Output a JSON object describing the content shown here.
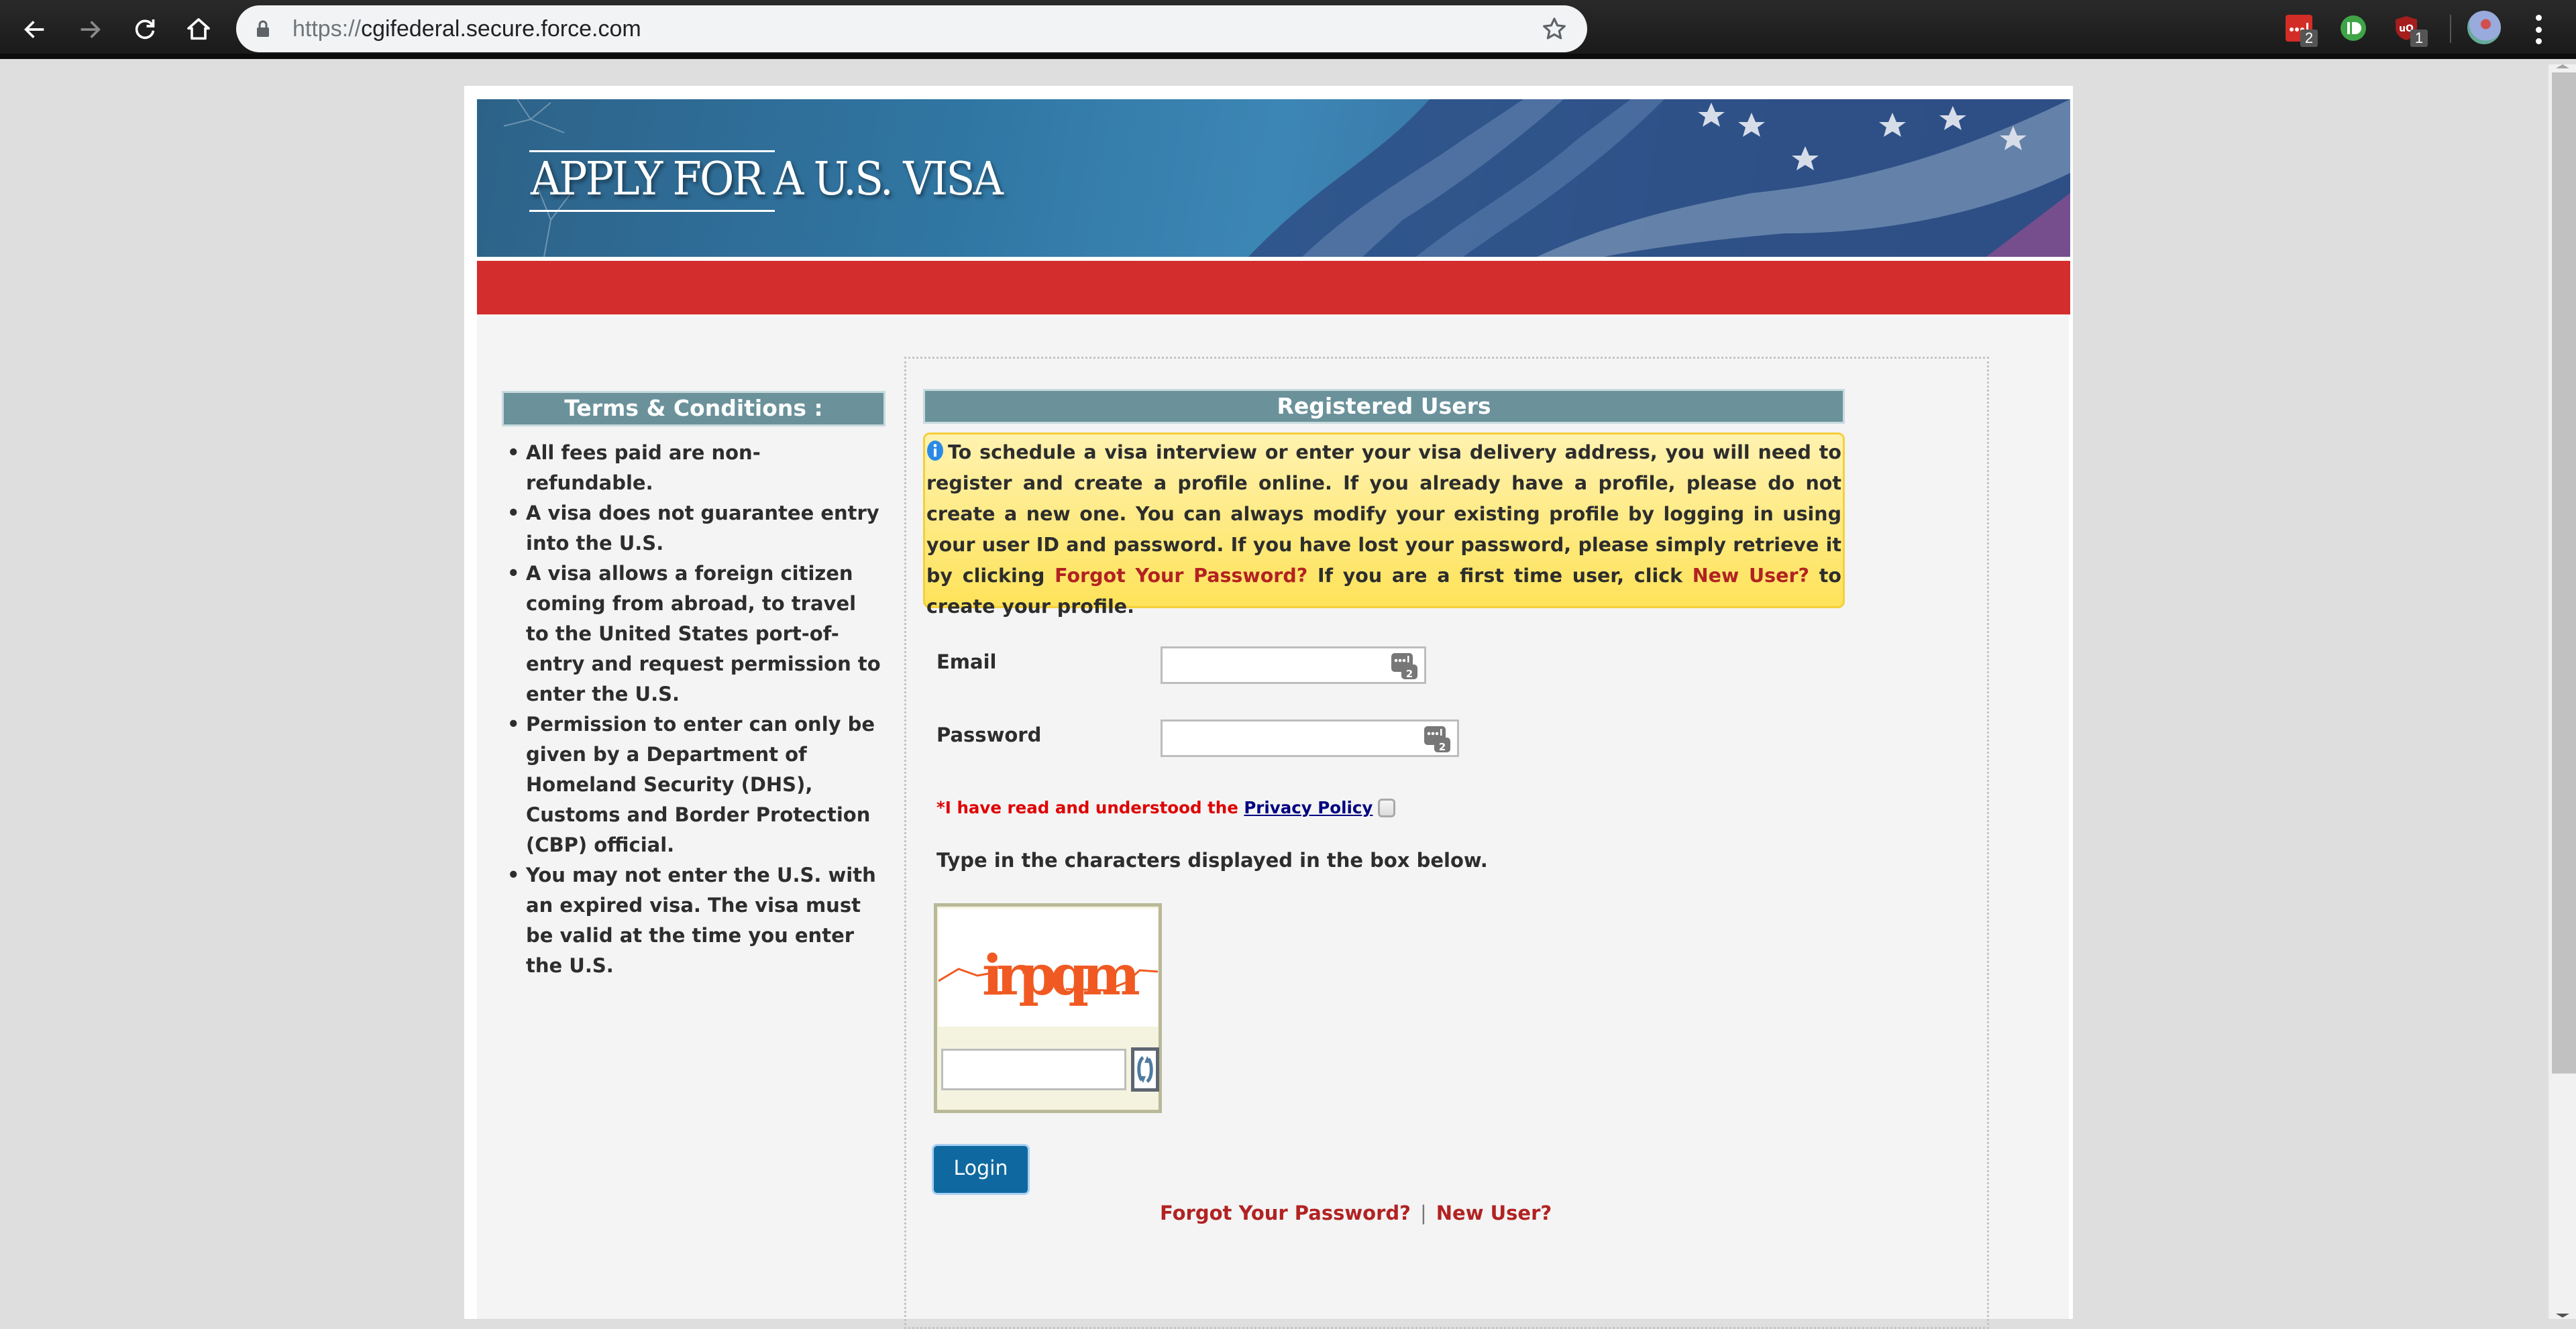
{
  "browser": {
    "url_scheme": "https://",
    "url_host": "cgifederal.secure.force.com",
    "extensions": [
      {
        "name": "lastpass",
        "badge": "2"
      },
      {
        "name": "pushbullet",
        "badge": ""
      },
      {
        "name": "ublock-origin",
        "badge": "1"
      }
    ]
  },
  "banner": {
    "title": "APPLY FOR A U.S. VISA"
  },
  "terms": {
    "heading": "Terms & Conditions :",
    "items": [
      "All fees paid are non-refundable.",
      "A visa does not guarantee entry into the U.S.",
      "A visa allows a foreign citizen coming from abroad, to travel to the United States port-of-entry and request permission to enter the U.S.",
      "Permission to enter can only be given by a Department of Homeland Security (DHS), Customs and Border Protection (CBP) official.",
      "You may not enter the U.S. with an expired visa. The visa must be valid at the time you enter the U.S."
    ]
  },
  "registered": {
    "heading": "Registered Users",
    "info_part1": "To schedule a visa interview or enter your visa delivery address, you will need to register and create a profile online. If you already have a profile, please do not create a new one. You can always modify your existing profile by logging in using your user ID and password. If you have lost your password, please simply retrieve it by clicking ",
    "info_link_forgot": "Forgot Your Password?",
    "info_part2": " If you are a first time user, click ",
    "info_link_new": "New User?",
    "info_part3": " to create your profile."
  },
  "form": {
    "email_label": "Email",
    "email_value": "",
    "password_label": "Password",
    "password_value": "",
    "privacy_prefix": "*I have read and understood the ",
    "privacy_link": "Privacy Policy",
    "privacy_checked": false,
    "captcha_prompt": "Type in the characters displayed in the box below.",
    "captcha_image_text": "irpqm",
    "captcha_value": "",
    "login_label": "Login",
    "forgot_link": "Forgot Your Password?",
    "separator": "|",
    "new_user_link": "New User?"
  },
  "colors": {
    "header_teal": "#6b929b",
    "banner_red": "#d42d2d",
    "link_red": "#b22222",
    "login_blue": "#0f69a0",
    "info_yellow": "#fee35a"
  }
}
